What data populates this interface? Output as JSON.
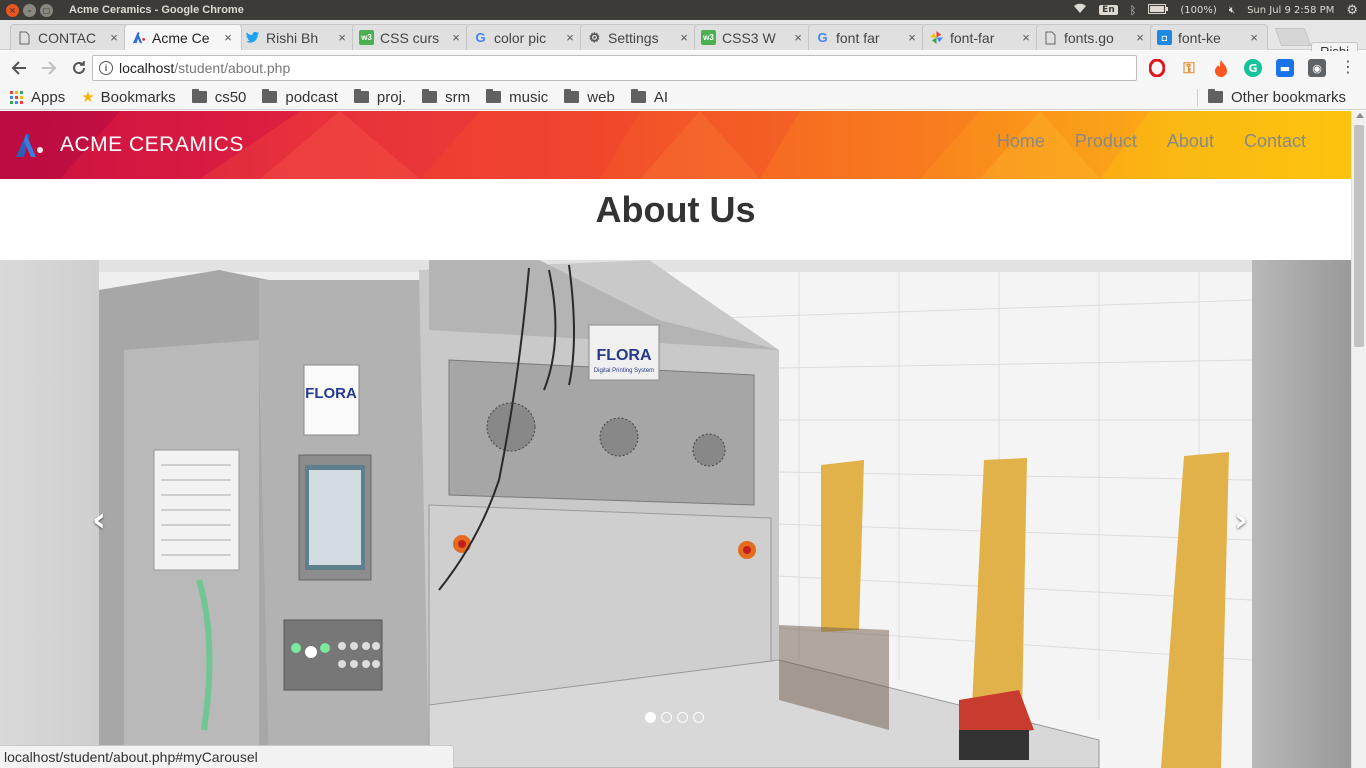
{
  "os": {
    "window_title": "Acme Ceramics - Google Chrome",
    "lang": "En",
    "battery": "(100%)",
    "clock": "Sun Jul  9  2:58 PM"
  },
  "tabs": [
    {
      "label": "CONTAC",
      "icon": "document-icon"
    },
    {
      "label": "Acme Ce",
      "icon": "acme-logo-icon",
      "active": true
    },
    {
      "label": "Rishi Bh",
      "icon": "twitter-icon"
    },
    {
      "label": "CSS curs",
      "icon": "w3schools-icon"
    },
    {
      "label": "color pic",
      "icon": "google-icon"
    },
    {
      "label": "Settings",
      "icon": "gear-icon"
    },
    {
      "label": "CSS3 W",
      "icon": "w3schools-icon"
    },
    {
      "label": "font far",
      "icon": "google-icon"
    },
    {
      "label": "font-far",
      "icon": "pinwheel-icon"
    },
    {
      "label": "fonts.go",
      "icon": "document-icon"
    },
    {
      "label": "font-ke",
      "icon": "bookmark-ext-icon"
    }
  ],
  "profile_name": "Rishi",
  "address": {
    "host": "localhost",
    "path": "/student/about.php"
  },
  "bookmarks": {
    "apps": "Apps",
    "bookmarks": "Bookmarks",
    "folders": [
      "cs50",
      "podcast",
      "proj.",
      "srm",
      "music",
      "web",
      "AI"
    ],
    "other": "Other bookmarks"
  },
  "site": {
    "brand": "ACME CERAMICS",
    "nav": [
      "Home",
      "Product",
      "About",
      "Contact"
    ],
    "heading": "About Us",
    "carousel": {
      "slide_count": 4,
      "active_index": 0,
      "prev_symbol": "‹",
      "next_symbol": "›",
      "machine_label": "FLORA",
      "machine_sub": "Digital Printing System"
    }
  },
  "status_url": "localhost/student/about.php#myCarousel",
  "colors": {
    "nav_gradient_start": "#c40d44",
    "nav_gradient_end": "#fcc40f",
    "nav_link": "#888888",
    "tile_yellow": "#e1b24a"
  }
}
